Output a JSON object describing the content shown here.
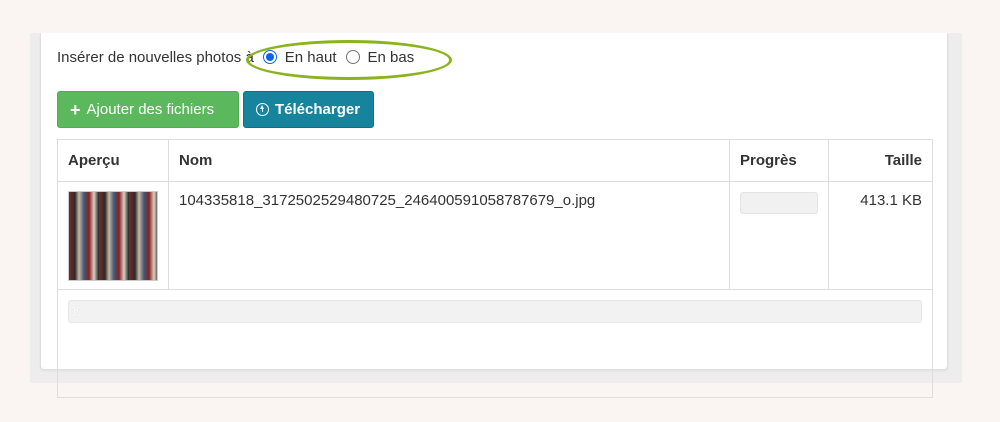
{
  "insert": {
    "label": "Insérer de nouvelles photos à",
    "options": [
      {
        "label": "En haut",
        "checked": true
      },
      {
        "label": "En bas",
        "checked": false
      }
    ]
  },
  "buttons": {
    "add_label": "Ajouter des fichiers",
    "upload_label": "Télécharger"
  },
  "table": {
    "headers": [
      "Aperçu",
      "Nom",
      "Progrès",
      "Taille"
    ],
    "rows": [
      {
        "name": "104335818_3172502529480725_246400591058787679_o.jpg",
        "size": "413.1 KB",
        "progress": 0
      }
    ],
    "total_progress_text": "0%"
  },
  "colors": {
    "add_button": "#5cb85c",
    "upload_button": "#17849e",
    "highlight": "#8bb31d",
    "radio_accent": "#0a66e8"
  },
  "icons": {
    "add": "plus-icon",
    "upload": "upload-circle-icon"
  }
}
